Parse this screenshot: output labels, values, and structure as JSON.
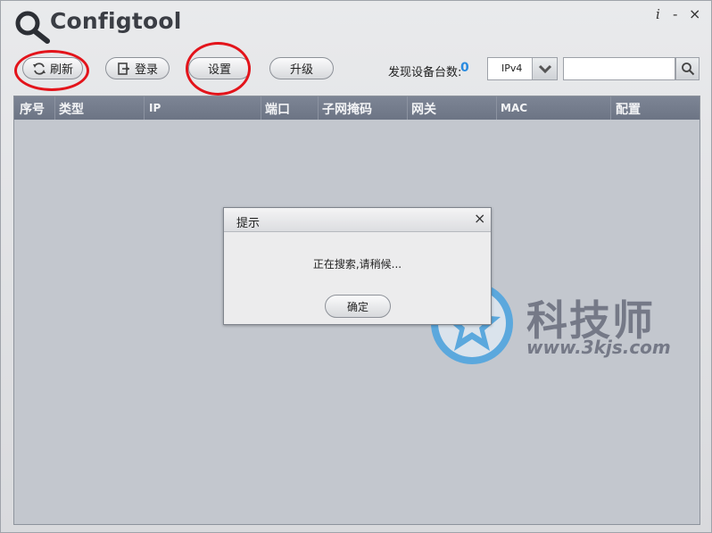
{
  "app": {
    "title": "Configtool",
    "info_icon": "info-icon",
    "minimize_label": "-",
    "close_label": "×"
  },
  "toolbar": {
    "refresh_label": "刷新",
    "login_label": "登录",
    "settings_label": "设置",
    "upgrade_label": "升级",
    "found_label": "发现设备台数:",
    "found_count": "0",
    "ip_version": "IPv4",
    "search_value": ""
  },
  "table": {
    "columns": [
      "序号",
      "类型",
      "IP",
      "端口",
      "子网掩码",
      "网关",
      "MAC",
      "配置"
    ],
    "rows": []
  },
  "dialog": {
    "title": "提示",
    "message": "正在搜索,请稍候...",
    "ok_label": "确定",
    "close_label": "×"
  },
  "watermark": {
    "name": "科技师",
    "url": "www.3kjs.com"
  },
  "colors": {
    "accent": "#2a8be0",
    "highlight": "#e3141b",
    "header": "#757d8d",
    "table_bg": "#c3c7ce"
  }
}
